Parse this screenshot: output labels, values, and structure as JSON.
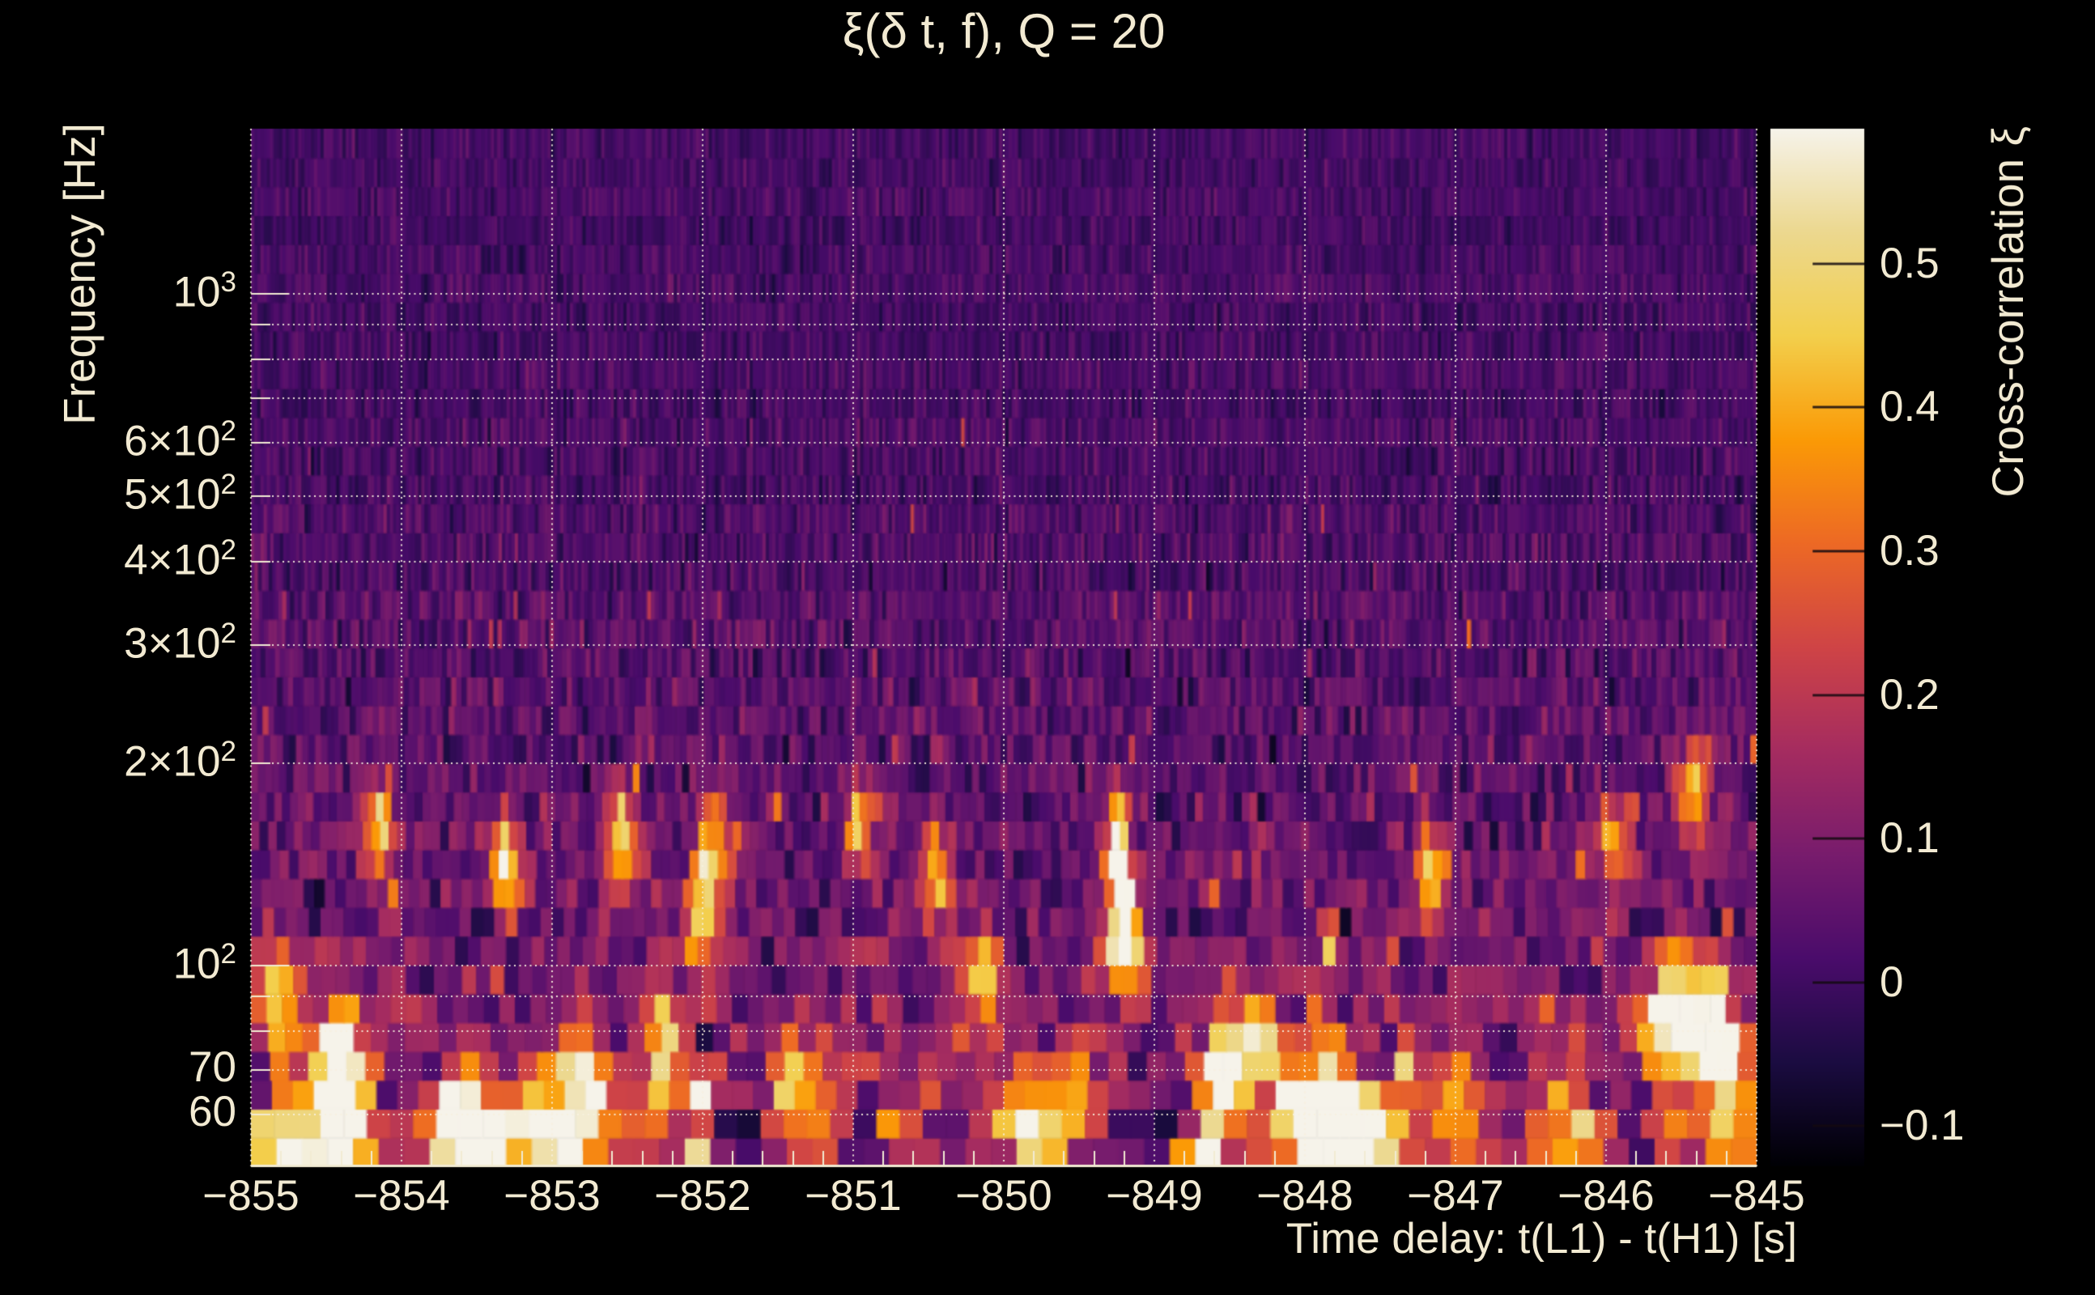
{
  "title": "ξ(δ t, f), Q = 20",
  "colors": {
    "background": "#000000",
    "text": "#f2ead2",
    "grid": "#f7f1de",
    "axis_line": "#f2ebd3",
    "colorbar_tick": "#140a10"
  },
  "chart_data": {
    "type": "heatmap",
    "title": "ξ(δ t, f), Q = 20",
    "xlabel": "Time delay: t(L1) - t(H1) [s]",
    "ylabel": "Frequency [Hz]",
    "colorbar_label": "Cross-correlation ξ",
    "x_range": [
      -855,
      -845
    ],
    "x_unit": "s",
    "y_scale": "log",
    "y_range_hz": [
      50.3,
      1762
    ],
    "value_range": [
      -0.128,
      0.594
    ],
    "x_ticks": [
      {
        "value": -855,
        "label": "−855"
      },
      {
        "value": -854,
        "label": "−854"
      },
      {
        "value": -853,
        "label": "−853"
      },
      {
        "value": -852,
        "label": "−852"
      },
      {
        "value": -851,
        "label": "−851"
      },
      {
        "value": -850,
        "label": "−850"
      },
      {
        "value": -849,
        "label": "−849"
      },
      {
        "value": -848,
        "label": "−848"
      },
      {
        "value": -847,
        "label": "−847"
      },
      {
        "value": -846,
        "label": "−846"
      },
      {
        "value": -845,
        "label": "−845"
      }
    ],
    "x_minor_step": 0.2,
    "y_ticks": [
      {
        "value": 1000,
        "base": "10",
        "exp": "3"
      },
      {
        "value": 600,
        "base": "6×10",
        "exp": "2"
      },
      {
        "value": 500,
        "base": "5×10",
        "exp": "2"
      },
      {
        "value": 400,
        "base": "4×10",
        "exp": "2"
      },
      {
        "value": 300,
        "base": "3×10",
        "exp": "2"
      },
      {
        "value": 200,
        "base": "2×10",
        "exp": "2"
      },
      {
        "value": 100,
        "base": "10",
        "exp": "2"
      },
      {
        "value": 70,
        "base": "70",
        "exp": ""
      },
      {
        "value": 60,
        "base": "60",
        "exp": ""
      }
    ],
    "y_gridlines_hz": [
      60,
      70,
      80,
      90,
      100,
      200,
      300,
      400,
      500,
      600,
      700,
      800,
      900,
      1000
    ],
    "colorbar_ticks": [
      {
        "value": 0.5,
        "label": "0.5"
      },
      {
        "value": 0.4,
        "label": "0.4"
      },
      {
        "value": 0.3,
        "label": "0.3"
      },
      {
        "value": 0.2,
        "label": "0.2"
      },
      {
        "value": 0.1,
        "label": "0.1"
      },
      {
        "value": 0,
        "label": "0"
      },
      {
        "value": -0.1,
        "label": "−0.1"
      }
    ],
    "colormap": {
      "name": "inferno-like (black–purple–red–orange–cream)",
      "stops": [
        "#000004",
        "#1b0c41",
        "#4a0c6b",
        "#781c6d",
        "#a52c60",
        "#cf4446",
        "#ed6925",
        "#fb9a06",
        "#f3cf4c",
        "#ecd88f",
        "#f6f3ea"
      ]
    },
    "grid_style": "dotted cream lines at every x second and every y decade multiple",
    "features": [
      {
        "t": -854.76,
        "f": 55,
        "xi": 0.38
      },
      {
        "t": -854.62,
        "f": 57,
        "xi": 0.34
      },
      {
        "t": -854.3,
        "f": 54,
        "xi": 0.3
      },
      {
        "t": -854.8,
        "f": 90,
        "xi": 0.3
      },
      {
        "t": -854.15,
        "f": 160,
        "xi": 0.3
      },
      {
        "t": -853.63,
        "f": 56,
        "xi": 0.6
      },
      {
        "t": -853.34,
        "f": 52,
        "xi": 0.4
      },
      {
        "t": -853.3,
        "f": 135,
        "xi": 0.4
      },
      {
        "t": -852.95,
        "f": 55,
        "xi": 0.32
      },
      {
        "t": -852.72,
        "f": 58,
        "xi": 0.34
      },
      {
        "t": -852.55,
        "f": 150,
        "xi": 0.34
      },
      {
        "t": -852.25,
        "f": 66,
        "xi": 0.3
      },
      {
        "t": -852.0,
        "f": 115,
        "xi": 0.42
      },
      {
        "t": -851.9,
        "f": 145,
        "xi": 0.3
      },
      {
        "t": -851.3,
        "f": 60,
        "xi": 0.3
      },
      {
        "t": -850.95,
        "f": 160,
        "xi": 0.3
      },
      {
        "t": -850.45,
        "f": 135,
        "xi": 0.36
      },
      {
        "t": -850.15,
        "f": 95,
        "xi": 0.3
      },
      {
        "t": -849.85,
        "f": 56,
        "xi": 0.4
      },
      {
        "t": -849.55,
        "f": 62,
        "xi": 0.3
      },
      {
        "t": -849.2,
        "f": 105,
        "xi": 0.48
      },
      {
        "t": -849.25,
        "f": 140,
        "xi": 0.34
      },
      {
        "t": -848.55,
        "f": 60,
        "xi": 0.32
      },
      {
        "t": -848.38,
        "f": 76,
        "xi": 0.46
      },
      {
        "t": -848.02,
        "f": 62,
        "xi": 0.52
      },
      {
        "t": -847.88,
        "f": 55,
        "xi": 0.36
      },
      {
        "t": -847.55,
        "f": 54,
        "xi": 0.44
      },
      {
        "t": -847.15,
        "f": 135,
        "xi": 0.36
      },
      {
        "t": -846.95,
        "f": 58,
        "xi": 0.3
      },
      {
        "t": -846.25,
        "f": 56,
        "xi": 0.36
      },
      {
        "t": -845.95,
        "f": 150,
        "xi": 0.3
      },
      {
        "t": -845.62,
        "f": 80,
        "xi": 0.4
      },
      {
        "t": -845.42,
        "f": 180,
        "xi": 0.32
      },
      {
        "t": -845.3,
        "f": 74,
        "xi": 0.55
      },
      {
        "t": -845.12,
        "f": 58,
        "xi": 0.36
      }
    ],
    "texture": {
      "rows": 36,
      "dt_coef": 9,
      "dt_min": 0.021,
      "dt_max": 0.18,
      "base0": 0.012,
      "base1": 0.075,
      "base_pow": 1.9,
      "sigma0": 0.05,
      "sigma1": 0.1,
      "sigma_pow": 1.7,
      "p0": 0.002,
      "p1": 0.05,
      "p_pow": 3,
      "p_midband_extra": 0.012,
      "band_boost": [
        {
          "f_lo": 70,
          "f_hi": 115,
          "boost": 0.03
        },
        {
          "f_lo": 130,
          "f_hi": 180,
          "boost": 0.015
        }
      ],
      "seed": 1234
    }
  }
}
